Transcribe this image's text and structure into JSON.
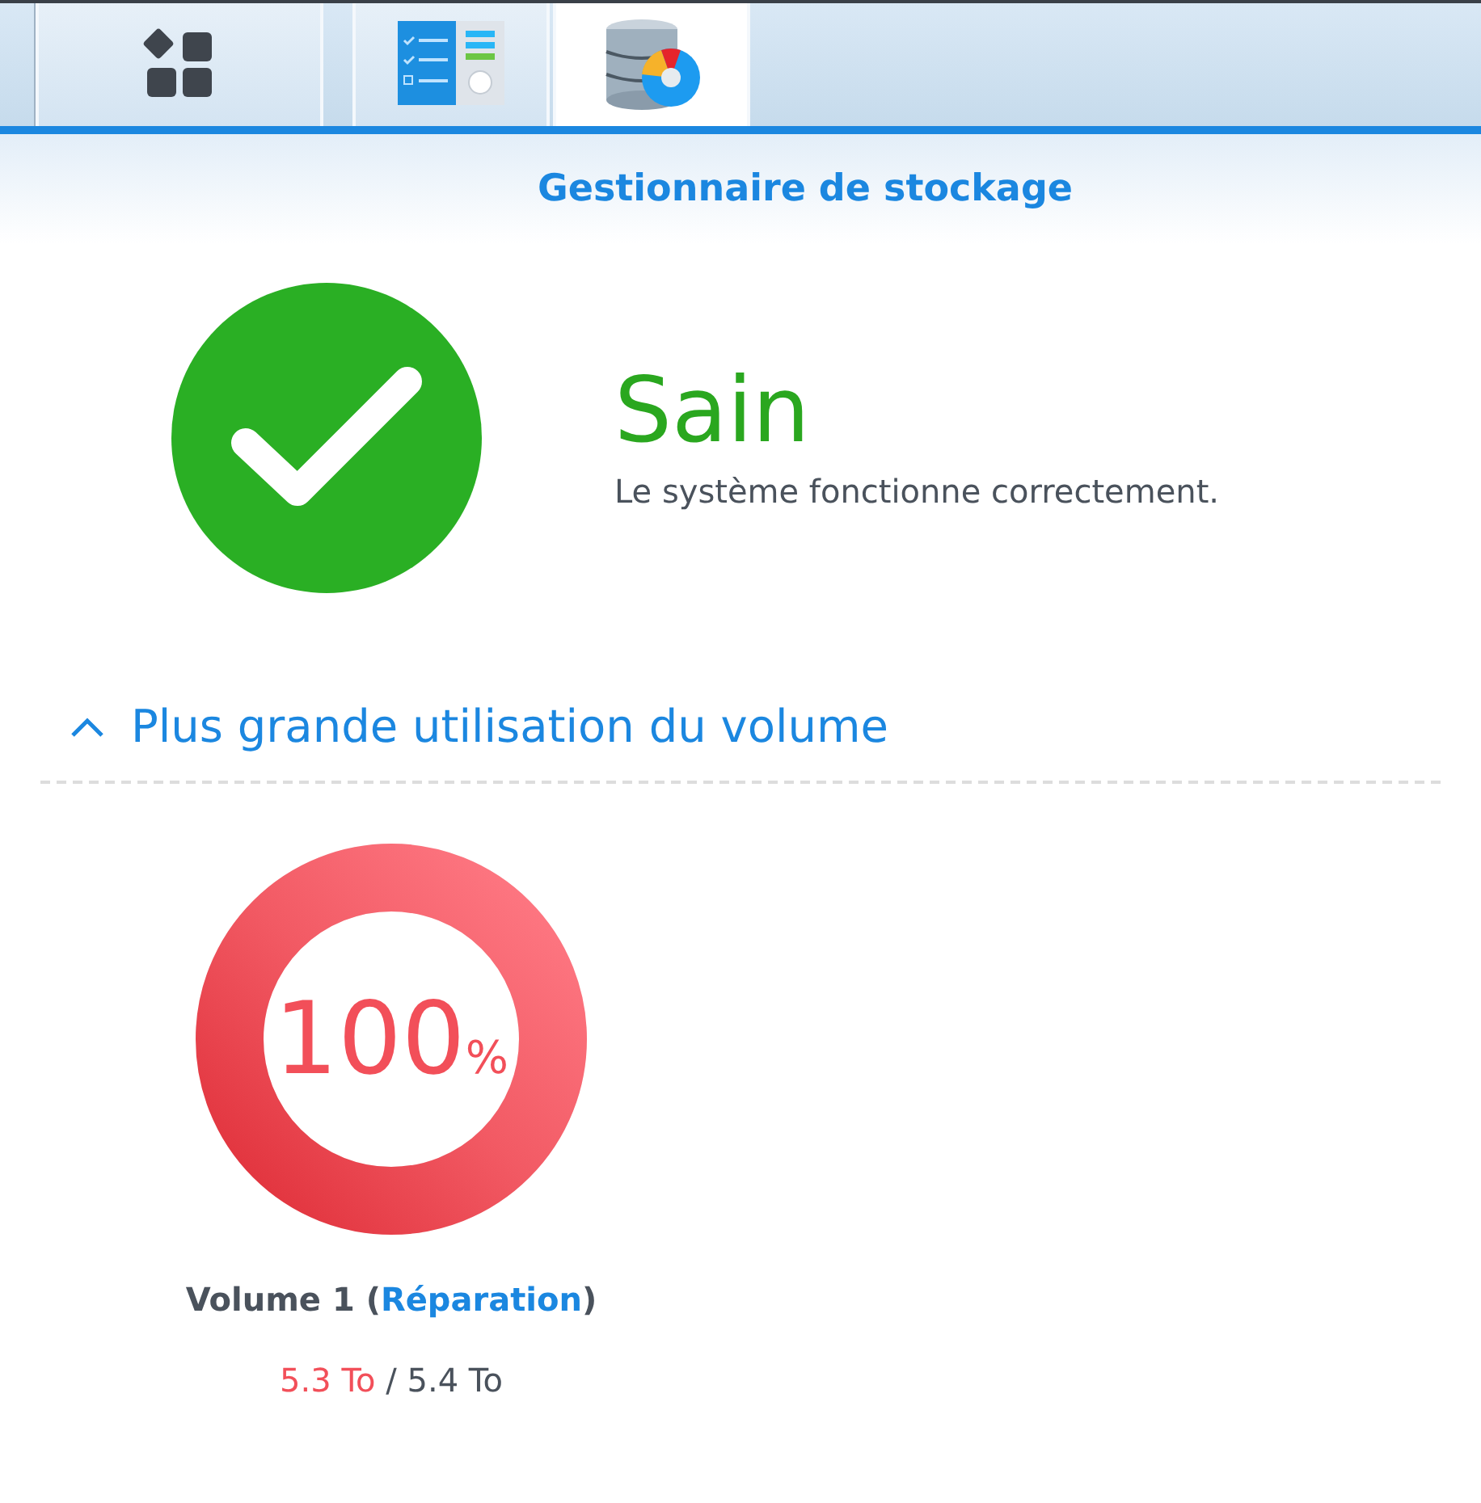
{
  "taskbar": {
    "tabs": [
      {
        "kind": "apps",
        "selected": false
      },
      {
        "kind": "control-panel",
        "selected": false
      },
      {
        "kind": "storage",
        "selected": true
      }
    ]
  },
  "window": {
    "title": "Gestionnaire de stockage"
  },
  "health": {
    "status": "Sain",
    "healthy": true,
    "message": "Le système fonctionne correctement."
  },
  "section": {
    "title": "Plus grande utilisation du volume",
    "expanded": true
  },
  "volumes": [
    {
      "level": 1,
      "percent": "100",
      "unit": "%",
      "label_prefix": "Volume 1 (",
      "status": "Réparation",
      "label_suffix": ")",
      "used": "5.3 To",
      "separator": "/",
      "total": "5.4 To"
    }
  ]
}
